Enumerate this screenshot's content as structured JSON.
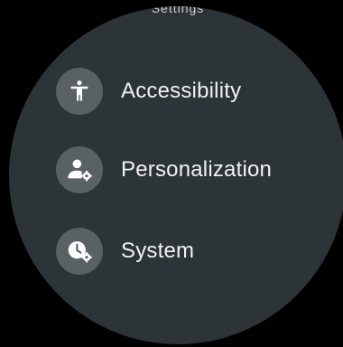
{
  "header": {
    "title": "Settings"
  },
  "menu": {
    "items": [
      {
        "label": "Accessibility",
        "icon": "accessibility-icon"
      },
      {
        "label": "Personalization",
        "icon": "personalization-icon"
      },
      {
        "label": "System",
        "icon": "system-icon"
      }
    ]
  },
  "colors": {
    "background": "#000000",
    "watch_face": "#2c3437",
    "icon_circle": "#5a6165",
    "text": "#f2f2f2"
  }
}
